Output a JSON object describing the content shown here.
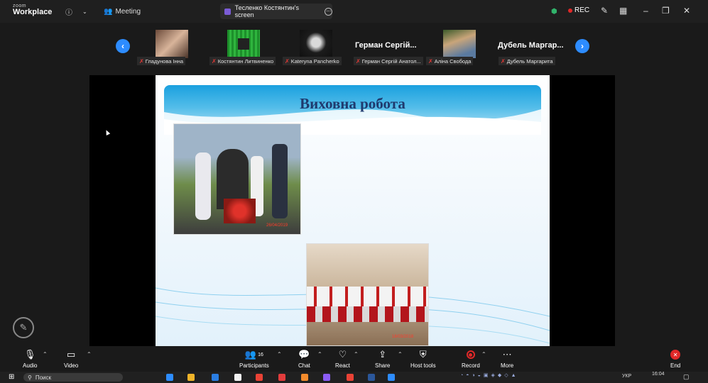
{
  "titlebar": {
    "brand_small": "zoom",
    "brand_large": "Workplace",
    "meeting_label": "Meeting",
    "share_tab_label": "Тесленко Костянтин's screen",
    "rec_label": "REC",
    "share_tab_color": "#7b5cd6",
    "rec_color": "#e02828"
  },
  "participants": [
    {
      "name": "Гладунова Інна"
    },
    {
      "name": "Костянтин Литвиненко"
    },
    {
      "name": "Kateryna Pancherko"
    },
    {
      "name": "Герман Сергій Анатол...",
      "big": "Герман Сергій..."
    },
    {
      "name": "Аліна Свобода"
    },
    {
      "name": "Дубель Маргарита",
      "big": "Дубель Маргар..."
    }
  ],
  "slide": {
    "title": "Виховна робота",
    "photo1_date": "26/04/2019",
    "photo2_date": "16/03/2018"
  },
  "toolbar": {
    "audio": "Audio",
    "video": "Video",
    "participants": "Participants",
    "participants_count": "16",
    "chat": "Chat",
    "react": "React",
    "share": "Share",
    "host_tools": "Host tools",
    "record": "Record",
    "more": "More",
    "end": "End",
    "accent": "#2d8cff",
    "end_color": "#e02828"
  },
  "taskbar": {
    "search_placeholder": "Поиск",
    "lang": "УКР",
    "time": "16:04"
  }
}
